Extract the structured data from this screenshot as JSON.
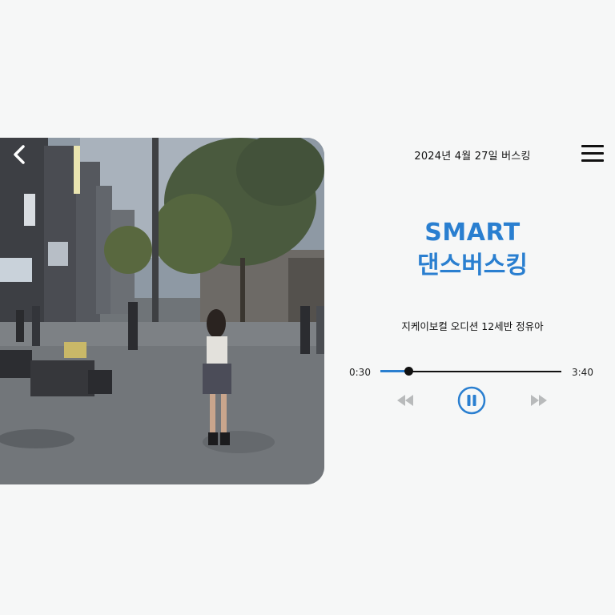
{
  "header": {
    "date_title": "2024년 4월 27일 버스킹"
  },
  "hero": {
    "title_line1": "SMART",
    "title_line2": "댄스버스킹",
    "subtitle": "지케이보컬 오디션 12세반 정유아"
  },
  "player": {
    "current_time": "0:30",
    "total_time": "3:40",
    "progress": 0.155,
    "state": "playing"
  },
  "icons": {
    "back": "chevron-left-icon",
    "menu": "hamburger-menu-icon",
    "rewind": "rewind-icon",
    "pause": "pause-icon",
    "forward": "fast-forward-icon"
  },
  "colors": {
    "accent": "#2a7fd0",
    "background": "#f6f7f7",
    "text": "#111111",
    "inactive_control": "#b8babb"
  }
}
